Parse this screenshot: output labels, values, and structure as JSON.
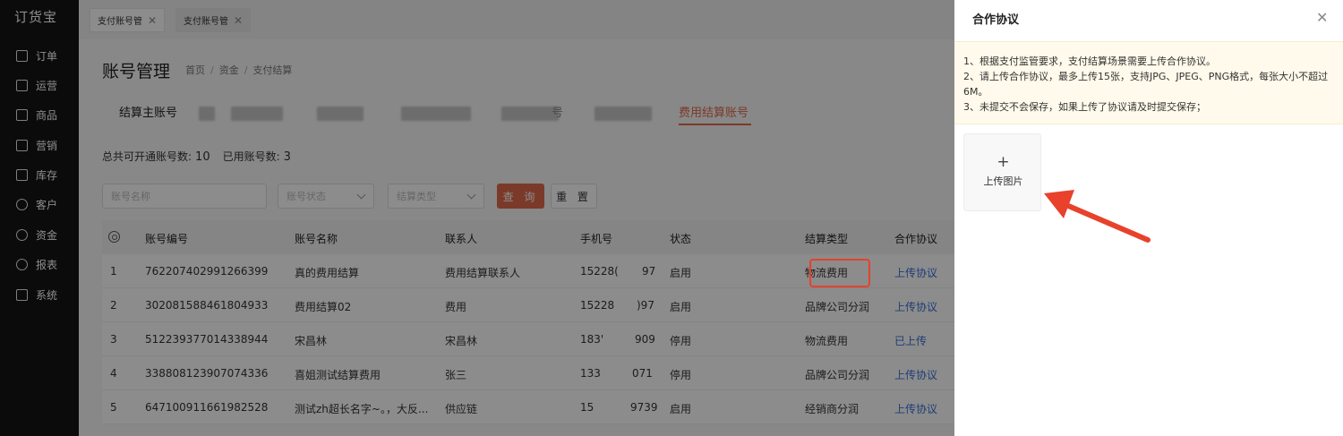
{
  "app": {
    "logo": "订货宝"
  },
  "sidebar": {
    "items": [
      {
        "label": "订单",
        "icon": "document-icon"
      },
      {
        "label": "运营",
        "icon": "chart-icon"
      },
      {
        "label": "商品",
        "icon": "grid-icon"
      },
      {
        "label": "营销",
        "icon": "bag-icon"
      },
      {
        "label": "库存",
        "icon": "house-icon"
      },
      {
        "label": "客户",
        "icon": "user-icon"
      },
      {
        "label": "资金",
        "icon": "coin-icon"
      },
      {
        "label": "报表",
        "icon": "pie-icon"
      },
      {
        "label": "系统",
        "icon": "monitor-icon"
      }
    ]
  },
  "tabs": [
    {
      "label": "支付账号管"
    },
    {
      "label": "支付账号管"
    }
  ],
  "header": {
    "title": "账号管理",
    "breadcrumb": [
      "首页",
      "资金",
      "支付结算"
    ]
  },
  "account_tabs": {
    "first": "结算主账号",
    "obscured_char": "号",
    "active": "费用结算账号"
  },
  "summary": {
    "total_label": "总共可开通账号数:",
    "total_value": "10",
    "used_label": "已用账号数:",
    "used_value": "3"
  },
  "filters": {
    "name_placeholder": "账号名称",
    "status_placeholder": "账号状态",
    "type_placeholder": "结算类型",
    "query_label": "查 询",
    "reset_label": "重 置"
  },
  "table": {
    "headers": [
      "账号编号",
      "账号名称",
      "联系人",
      "手机号",
      "状态",
      "结算类型",
      "合作协议"
    ],
    "rows": [
      {
        "idx": "1",
        "id": "762207402991266399",
        "name": "真的费用结算",
        "contact": "费用结算联系人",
        "phone_a": "15228(",
        "phone_b": "97",
        "status": "启用",
        "type": "物流费用",
        "agreement": "上传协议"
      },
      {
        "idx": "2",
        "id": "302081588461804933",
        "name": "费用结算02",
        "contact": "费用",
        "phone_a": "15228",
        "phone_b": ")97",
        "status": "启用",
        "type": "品牌公司分润",
        "agreement": "上传协议"
      },
      {
        "idx": "3",
        "id": "512239377014338944",
        "name": "宋昌林",
        "contact": "宋昌林",
        "phone_a": "183'",
        "phone_b": "909",
        "status": "停用",
        "type": "物流费用",
        "agreement": "已上传"
      },
      {
        "idx": "4",
        "id": "338808123907074336",
        "name": "喜姐测试结算费用",
        "contact": "张三",
        "phone_a": "133",
        "phone_b": "071",
        "status": "停用",
        "type": "品牌公司分润",
        "agreement": "上传协议"
      },
      {
        "idx": "5",
        "id": "647100911661982528",
        "name": "测试zh超长名字~。，大反...",
        "contact": "供应链",
        "phone_a": "15",
        "phone_b": "9739",
        "status": "启用",
        "type": "经销商分润",
        "agreement": "上传协议"
      }
    ]
  },
  "drawer": {
    "title": "合作协议",
    "notice": [
      "1、根据支付监管要求，支付结算场景需要上传合作协议。",
      "2、请上传合作协议，最多上传15张，支持JPG、JPEG、PNG格式，每张大小不超过6M。",
      "3、未提交不会保存，如果上传了协议请及时提交保存；"
    ],
    "upload_label": "上传图片",
    "upload_icon": "plus-icon"
  },
  "colors": {
    "accent": "#e06a4b",
    "link": "#3a6fd8",
    "annotation": "#e8412c",
    "sidebar_bg": "#141414"
  }
}
